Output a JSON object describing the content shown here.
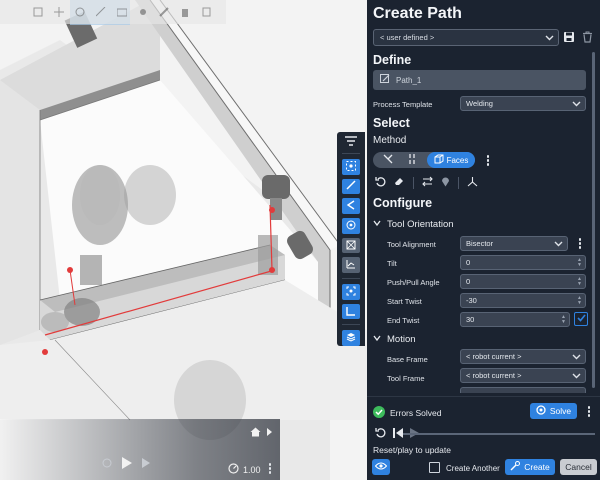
{
  "viewport": {
    "playback": {
      "speed": "1.00"
    }
  },
  "panel": {
    "title": "Create Path",
    "preset_value": "< user defined >",
    "define_heading": "Define",
    "path_name": "Path_1",
    "process_template_label": "Process Template",
    "process_template_value": "Welding",
    "select_heading": "Select",
    "method_label": "Method",
    "method_active": "Faces",
    "configure_heading": "Configure",
    "tool_orientation_heading": "Tool Orientation",
    "tool_alignment_label": "Tool Alignment",
    "tool_alignment_value": "Bisector",
    "tilt_label": "Tilt",
    "tilt_value": "0",
    "push_pull_label": "Push/Pull Angle",
    "push_pull_value": "0",
    "start_twist_label": "Start Twist",
    "start_twist_value": "-30",
    "end_twist_label": "End Twist",
    "end_twist_value": "30",
    "motion_heading": "Motion",
    "base_frame_label": "Base Frame",
    "base_frame_value": "< robot current >",
    "tool_frame_label": "Tool Frame",
    "tool_frame_value": "< robot current >"
  },
  "footer": {
    "status_text": "Errors Solved",
    "solve_label": "Solve",
    "reset_text": "Reset/play to update",
    "create_another_label": "Create Another",
    "create_label": "Create",
    "cancel_label": "Cancel"
  },
  "colors": {
    "accent": "#2f82e0",
    "panel_bg": "#1b2330",
    "success": "#3dbb5c",
    "weld_path": "#e23b3b"
  },
  "icons": [
    "filter-icon",
    "save-icon",
    "trash-icon",
    "edit-icon",
    "eye-icon",
    "play-icon",
    "undo-icon",
    "eraser-icon",
    "swap-icon",
    "pin-icon",
    "axes-icon",
    "home-icon",
    "check-circle-icon",
    "solve-icon",
    "create-icon",
    "layers-icon",
    "chevron-down-icon"
  ]
}
